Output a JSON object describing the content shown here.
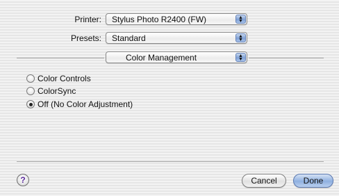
{
  "printer": {
    "label": "Printer:",
    "value": "Stylus Photo R2400 (FW)"
  },
  "presets": {
    "label": "Presets:",
    "value": "Standard"
  },
  "panel": {
    "value": "Color Management"
  },
  "color_options": [
    {
      "label": "Color Controls",
      "selected": false
    },
    {
      "label": "ColorSync",
      "selected": false
    },
    {
      "label": "Off (No Color Adjustment)",
      "selected": true
    }
  ],
  "buttons": {
    "help": "?",
    "cancel": "Cancel",
    "done": "Done"
  }
}
